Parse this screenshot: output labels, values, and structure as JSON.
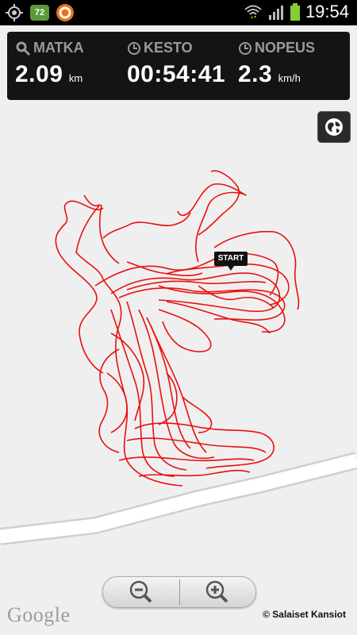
{
  "status_bar": {
    "badge": "72",
    "time": "19:54",
    "icons": [
      "gps-icon",
      "notification-badge-icon",
      "app-icon",
      "wifi-icon",
      "signal-icon",
      "battery-icon"
    ]
  },
  "stats": {
    "distance": {
      "label": "MATKA",
      "value": "2.09",
      "unit": "km",
      "icon": "search-icon"
    },
    "duration": {
      "label": "KESTO",
      "value": "00:54:41",
      "icon": "clock-icon"
    },
    "speed": {
      "label": "NOPEUS",
      "value": "2.3",
      "unit": "km/h",
      "icon": "clock-icon"
    }
  },
  "map": {
    "start_label": "START",
    "google_logo": "Google",
    "copyright": "© Salaiset Kansiot",
    "track_color": "#e8100e",
    "road_color": "#ffffff"
  },
  "zoom": {
    "out_icon": "zoom-out-icon",
    "in_icon": "zoom-in-icon"
  }
}
